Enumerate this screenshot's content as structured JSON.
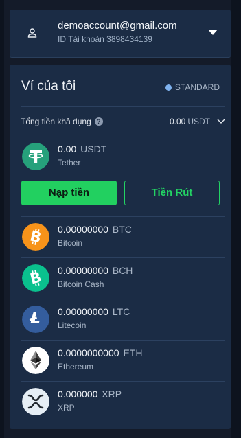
{
  "account": {
    "email": "demoaccount@gmail.com",
    "id_line": "ID Tài khoản 3898434139"
  },
  "wallet": {
    "title": "Ví của tôi",
    "tier": "STANDARD",
    "available_label": "Tổng tiền khả dụng",
    "available_value": "0.00",
    "available_unit": "USDT",
    "deposit_label": "Nạp tiền",
    "withdraw_label": "Tiền Rút",
    "primary_coin": {
      "amount": "0.00",
      "symbol": "USDT",
      "name": "Tether"
    },
    "coins": [
      {
        "amount": "0.00000000",
        "symbol": "BTC",
        "name": "Bitcoin",
        "icon": "bitcoin-icon",
        "color": "#f7931a"
      },
      {
        "amount": "0.00000000",
        "symbol": "BCH",
        "name": "Bitcoin Cash",
        "icon": "bitcoin-cash-icon",
        "color": "#0ac18e"
      },
      {
        "amount": "0.00000000",
        "symbol": "LTC",
        "name": "Litecoin",
        "icon": "litecoin-icon",
        "color": "#345d9d"
      },
      {
        "amount": "0.0000000000",
        "symbol": "ETH",
        "name": "Ethereum",
        "icon": "ethereum-icon",
        "color": "#ffffff"
      },
      {
        "amount": "0.000000",
        "symbol": "XRP",
        "name": "XRP",
        "icon": "xrp-icon",
        "color": "#e6eef5"
      }
    ]
  },
  "colors": {
    "background": "#141b29",
    "panel": "#1b2c45",
    "accent_green": "#22d060",
    "tether": "#26a17b"
  }
}
